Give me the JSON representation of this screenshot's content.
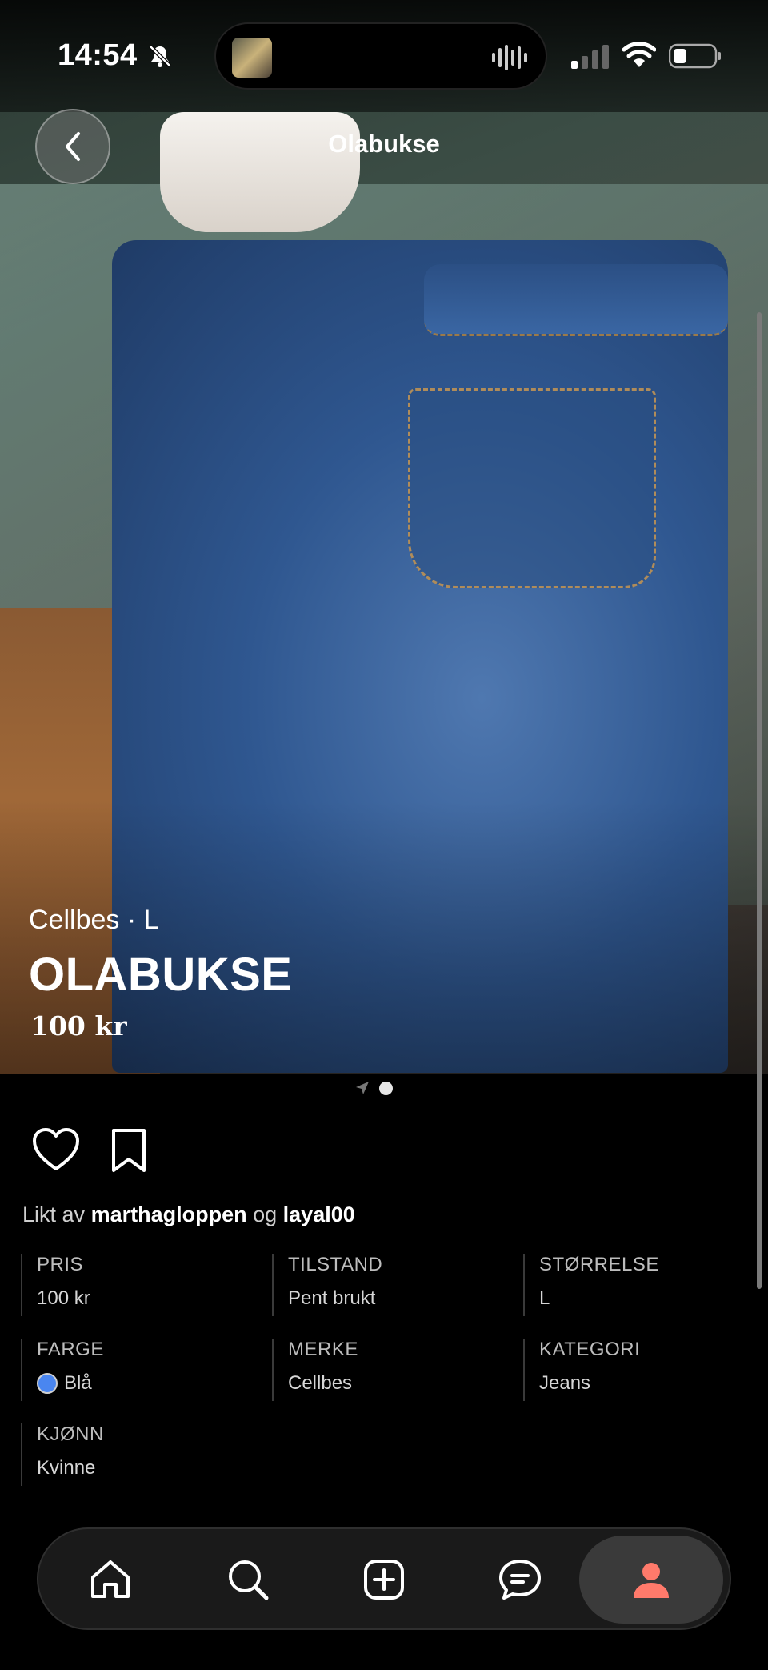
{
  "status_bar": {
    "time": "14:54"
  },
  "header": {
    "title": "Olabukse"
  },
  "listing": {
    "brand_size": "Cellbes · L",
    "title": "OLABUKSE",
    "price": "100 kr",
    "image_count": 1,
    "current_image": 1
  },
  "likes": {
    "prefix": "Likt av",
    "user1": "marthagloppen",
    "joiner": "og",
    "user2": "layal00"
  },
  "attributes": {
    "price_label": "PRIS",
    "price_value": "100 kr",
    "condition_label": "TILSTAND",
    "condition_value": "Pent brukt",
    "size_label": "STØRRELSE",
    "size_value": "L",
    "color_label": "FARGE",
    "color_value": "Blå",
    "color_hex": "#4a86f0",
    "brand_label": "MERKE",
    "brand_value": "Cellbes",
    "category_label": "KATEGORI",
    "category_value": "Jeans",
    "gender_label": "KJØNN",
    "gender_value": "Kvinne"
  },
  "bottom_nav": {
    "items": [
      "home-icon",
      "search-icon",
      "add-icon",
      "messages-icon",
      "profile-icon"
    ],
    "active": "profile-icon",
    "accent_color": "#ff7a6b"
  }
}
